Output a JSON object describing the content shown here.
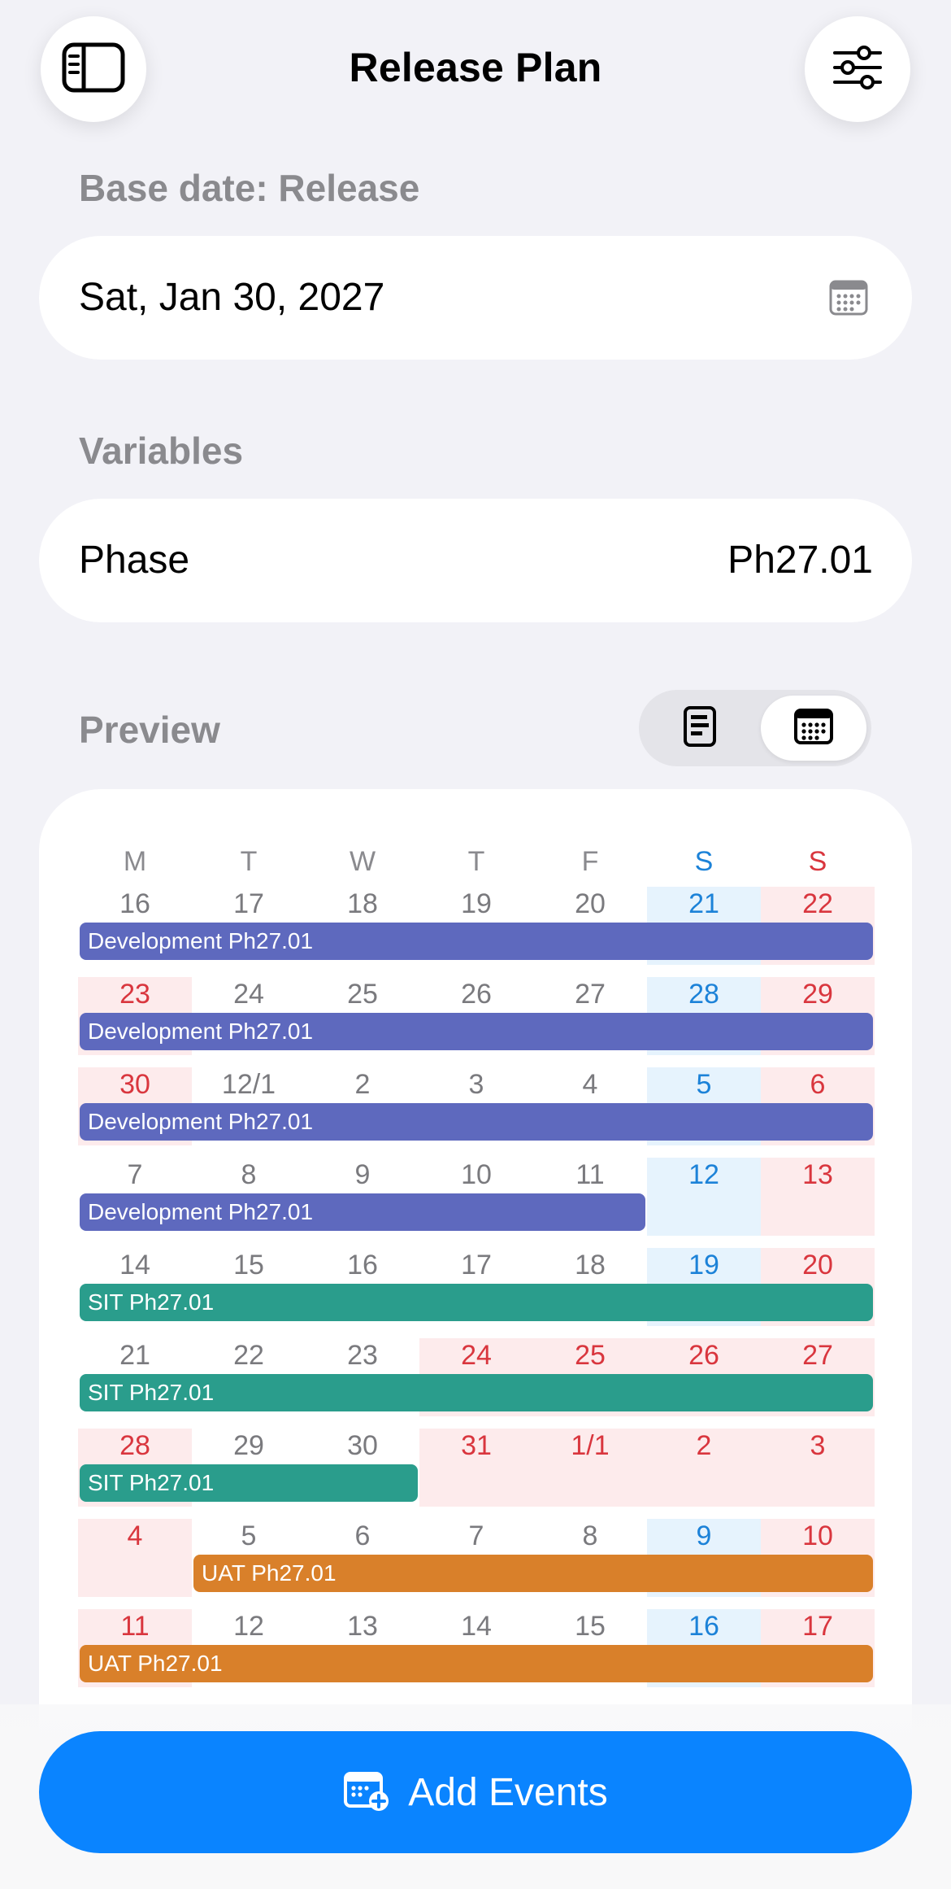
{
  "header": {
    "title": "Release Plan",
    "sidebar_icon": "sidebar-icon",
    "settings_icon": "sliders-icon"
  },
  "base_date": {
    "label": "Base date: Release",
    "value": "Sat, Jan 30, 2027",
    "icon": "calendar-icon"
  },
  "variables": {
    "label": "Variables",
    "name": "Phase",
    "value": "Ph27.01"
  },
  "preview": {
    "label": "Preview",
    "view_options": [
      "list-view-icon",
      "calendar-view-icon"
    ],
    "selected_view": "calendar"
  },
  "calendar": {
    "weekdays": [
      "M",
      "T",
      "W",
      "T",
      "F",
      "S",
      "S"
    ],
    "weeks": [
      {
        "days": [
          "16",
          "17",
          "18",
          "19",
          "20",
          "21",
          "22"
        ],
        "red": [
          6
        ],
        "blue": [
          5
        ]
      },
      {
        "days": [
          "23",
          "24",
          "25",
          "26",
          "27",
          "28",
          "29"
        ],
        "red": [
          0,
          6
        ],
        "blue": [
          5
        ]
      },
      {
        "days": [
          "30",
          "12/1",
          "2",
          "3",
          "4",
          "5",
          "6"
        ],
        "red": [
          0,
          6
        ],
        "blue": [
          5
        ]
      },
      {
        "days": [
          "7",
          "8",
          "9",
          "10",
          "11",
          "12",
          "13"
        ],
        "red": [
          6
        ],
        "blue": [
          5
        ]
      },
      {
        "days": [
          "14",
          "15",
          "16",
          "17",
          "18",
          "19",
          "20"
        ],
        "red": [
          6
        ],
        "blue": [
          5
        ]
      },
      {
        "days": [
          "21",
          "22",
          "23",
          "24",
          "25",
          "26",
          "27"
        ],
        "red": [
          3,
          4,
          5,
          6
        ],
        "blue": []
      },
      {
        "days": [
          "28",
          "29",
          "30",
          "31",
          "1/1",
          "2",
          "3"
        ],
        "red": [
          0,
          3,
          4,
          5,
          6
        ],
        "blue": []
      },
      {
        "days": [
          "4",
          "5",
          "6",
          "7",
          "8",
          "9",
          "10"
        ],
        "red": [
          0,
          6
        ],
        "blue": [
          5
        ]
      },
      {
        "days": [
          "11",
          "12",
          "13",
          "14",
          "15",
          "16",
          "17"
        ],
        "red": [
          0,
          6
        ],
        "blue": [
          5
        ]
      }
    ],
    "events": [
      {
        "week": 0,
        "label": "Development Ph27.01",
        "color": "#5E69BE"
      },
      {
        "week": 1,
        "label": "Development Ph27.01",
        "color": "#5E69BE"
      },
      {
        "week": 2,
        "label": "Development Ph27.01",
        "color": "#5E69BE"
      },
      {
        "week": 3,
        "label": "Development Ph27.01",
        "color": "#5E69BE"
      },
      {
        "week": 4,
        "label": "SIT Ph27.01",
        "color": "#2A9D8C"
      },
      {
        "week": 5,
        "label": "SIT Ph27.01",
        "color": "#2A9D8C"
      },
      {
        "week": 6,
        "label": "SIT Ph27.01",
        "color": "#2A9D8C"
      },
      {
        "week": 7,
        "label": "UAT Ph27.01",
        "color": "#D9802A"
      },
      {
        "week": 8,
        "label": "UAT Ph27.01",
        "color": "#D9802A"
      }
    ]
  },
  "footer": {
    "add_events_label": "Add Events",
    "add_icon": "calendar-add-icon",
    "accent": "#0A84FF"
  }
}
